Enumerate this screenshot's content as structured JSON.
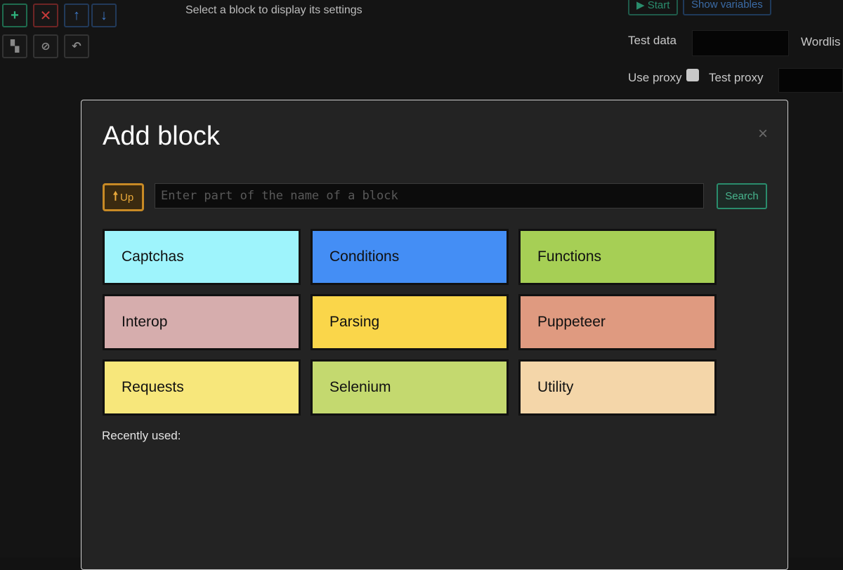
{
  "toolbar": {
    "add_icon": "plus-icon",
    "remove_icon": "x-icon",
    "move_up_icon": "arrow-up-icon",
    "move_down_icon": "arrow-down-icon",
    "clone_icon": "clone-icon",
    "disable_icon": "disable-icon",
    "undo_icon": "undo-icon"
  },
  "hint": "Select a block to display its settings",
  "debugger": {
    "start_label": "▶ Start",
    "show_variables_label": "Show variables",
    "test_data_label": "Test data",
    "wordlist_label": "Wordlis",
    "use_proxy_label": "Use proxy",
    "test_proxy_label": "Test proxy"
  },
  "modal": {
    "title": "Add block",
    "close_label": "×",
    "up_label": "Up",
    "up_arrow": "🠕",
    "search_placeholder": "Enter part of the name of a block",
    "search_value": "",
    "search_label": "Search",
    "categories": [
      {
        "label": "Captchas",
        "color": "#9ef4fc"
      },
      {
        "label": "Conditions",
        "color": "#448ef5"
      },
      {
        "label": "Functions",
        "color": "#a6cf55"
      },
      {
        "label": "Interop",
        "color": "#d6adad"
      },
      {
        "label": "Parsing",
        "color": "#fad64a"
      },
      {
        "label": "Puppeteer",
        "color": "#df9a80"
      },
      {
        "label": "Requests",
        "color": "#f7e77b"
      },
      {
        "label": "Selenium",
        "color": "#c4d96f"
      },
      {
        "label": "Utility",
        "color": "#f4d6a9"
      }
    ],
    "recently_used_label": "Recently used:"
  }
}
